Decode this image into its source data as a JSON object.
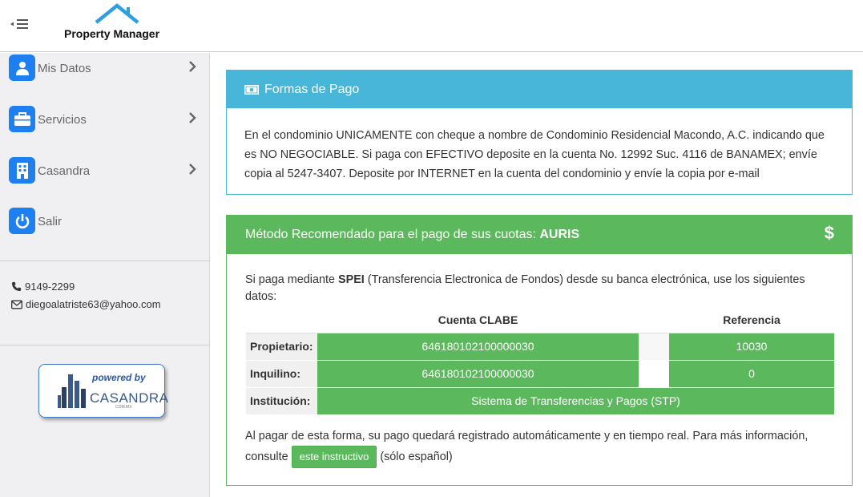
{
  "header": {
    "app_title": "Property Manager"
  },
  "sidebar": {
    "items": [
      {
        "label": "Mis Datos",
        "icon": "user-icon"
      },
      {
        "label": "Servicios",
        "icon": "briefcase-icon"
      },
      {
        "label": "Casandra",
        "icon": "building-icon"
      },
      {
        "label": "Salir",
        "icon": "power-icon"
      }
    ],
    "phone": "9149-2299",
    "email": "diegoalatriste63@yahoo.com",
    "powered": {
      "line1": "powered by",
      "brand": "CASANDRA",
      "sub": "COM.MX"
    }
  },
  "payment_info": {
    "title": "Formas de Pago",
    "body": "En el condominio UNICAMENTE con cheque a nombre de Condominio Residencial Macondo, A.C. indicando que es NO NEGOCIABLE. Si paga con EFECTIVO deposite en la cuenta No. 12992 Suc. 4116 de BANAMEX; envíe copia al 5247-3407. Deposite por INTERNET en la cuenta del condominio y envíe la copia por e-mail"
  },
  "recommended": {
    "title_prefix": "Método Recomendado para el pago de sus cuotas: ",
    "title_method": "AURIS",
    "dollar": "$",
    "intro_prefix": "Si paga mediante ",
    "intro_bold": "SPEI",
    "intro_suffix": " (Transferencia Electronica de Fondos) desde su banca electrónica, use los siguientes datos:",
    "table": {
      "headers": [
        "Cuenta CLABE",
        "Referencia"
      ],
      "rows": [
        {
          "label": "Propietario:",
          "clabe": "646180102100000030",
          "ref": "10030"
        },
        {
          "label": "Inquilino:",
          "clabe": "646180102100000030",
          "ref": "0"
        }
      ],
      "institution_label": "Institución:",
      "institution_value": "Sistema de Transferencias y Pagos (STP)"
    },
    "closing_text": "Al pagar de esta forma, su pago quedará registrado automáticamente y en tiempo real. Para más información, consulte",
    "button_label": "este instructivo",
    "closing_suffix": "(sólo español)"
  },
  "colors": {
    "info": "#48b6d9",
    "success": "#5cb85c",
    "icon_blue": "#1e7ff0"
  }
}
